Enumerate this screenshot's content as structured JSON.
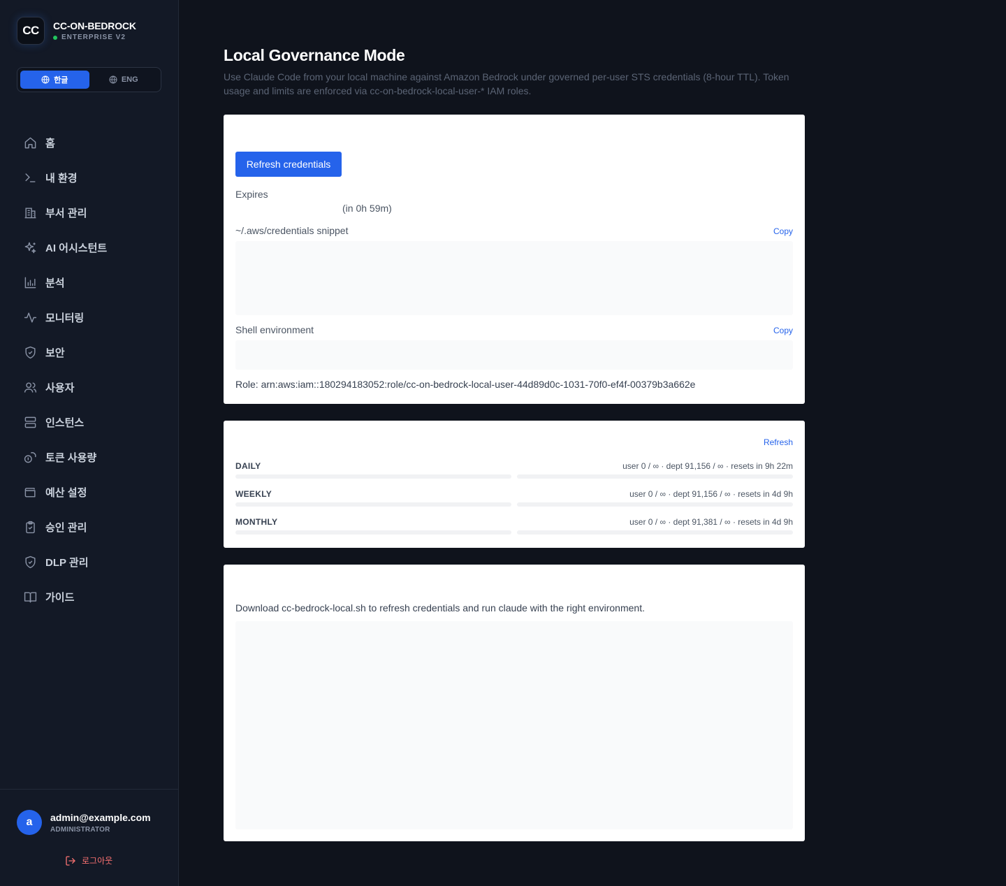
{
  "sidebar": {
    "brand": {
      "logo": "CC",
      "name": "CC-ON-BEDROCK",
      "subtitle": "ENTERPRISE V2"
    },
    "lang": {
      "korean": "한글",
      "english": "ENG",
      "active": "korean"
    },
    "nav": [
      {
        "label": "홈",
        "icon": "home-icon"
      },
      {
        "label": "내 환경",
        "icon": "terminal-icon"
      },
      {
        "label": "부서 관리",
        "icon": "building-icon"
      },
      {
        "label": "AI 어시스턴트",
        "icon": "sparkles-icon"
      },
      {
        "label": "분석",
        "icon": "bar-chart-icon"
      },
      {
        "label": "모니터링",
        "icon": "activity-icon"
      },
      {
        "label": "보안",
        "icon": "shield-check-icon"
      },
      {
        "label": "사용자",
        "icon": "users-icon"
      },
      {
        "label": "인스턴스",
        "icon": "server-icon"
      },
      {
        "label": "토큰 사용량",
        "icon": "coins-icon"
      },
      {
        "label": "예산 설정",
        "icon": "wallet-icon"
      },
      {
        "label": "승인 관리",
        "icon": "clipboard-check-icon"
      },
      {
        "label": "DLP 관리",
        "icon": "shield-check-icon"
      },
      {
        "label": "가이드",
        "icon": "book-open-icon"
      }
    ],
    "user": {
      "initial": "a",
      "email": "admin@example.com",
      "role": "ADMINISTRATOR"
    },
    "logout": "로그아웃"
  },
  "header": {
    "title": "Local Governance Mode",
    "description": "Use Claude Code from your local machine against Amazon Bedrock under governed per-user STS credentials (8-hour TTL). Token usage and limits are enforced via cc-on-bedrock-local-user-* IAM roles."
  },
  "credentials": {
    "refresh_button": "Refresh credentials",
    "expires_label": "Expires",
    "expires_relative": "(in 0h 59m)",
    "snippet_label": "~/.aws/credentials snippet",
    "copy_label": "Copy",
    "shell_label": "Shell environment",
    "role": "Role: arn:aws:iam::180294183052:role/cc-on-bedrock-local-user-44d89d0c-1031-70f0-ef4f-00379b3a662e"
  },
  "limits": {
    "refresh_label": "Refresh",
    "rows": [
      {
        "label": "DAILY",
        "stats": "user 0 / ∞ · dept 91,156 / ∞ · resets in 9h 22m",
        "user_fraction": 0,
        "dept_fraction": 0
      },
      {
        "label": "WEEKLY",
        "stats": "user 0 / ∞ · dept 91,156 / ∞ · resets in 4d 9h",
        "user_fraction": 0,
        "dept_fraction": 0
      },
      {
        "label": "MONTHLY",
        "stats": "user 0 / ∞ · dept 91,381 / ∞ · resets in 4d 9h",
        "user_fraction": 0,
        "dept_fraction": 0
      }
    ]
  },
  "download": {
    "text": "Download cc-bedrock-local.sh to refresh credentials and run claude with the right environment."
  },
  "colors": {
    "accent": "#2563eb",
    "sidebar_bg": "#131926",
    "page_bg": "#0f131c",
    "status_dot": "#22c55e",
    "logout": "#f87171"
  }
}
